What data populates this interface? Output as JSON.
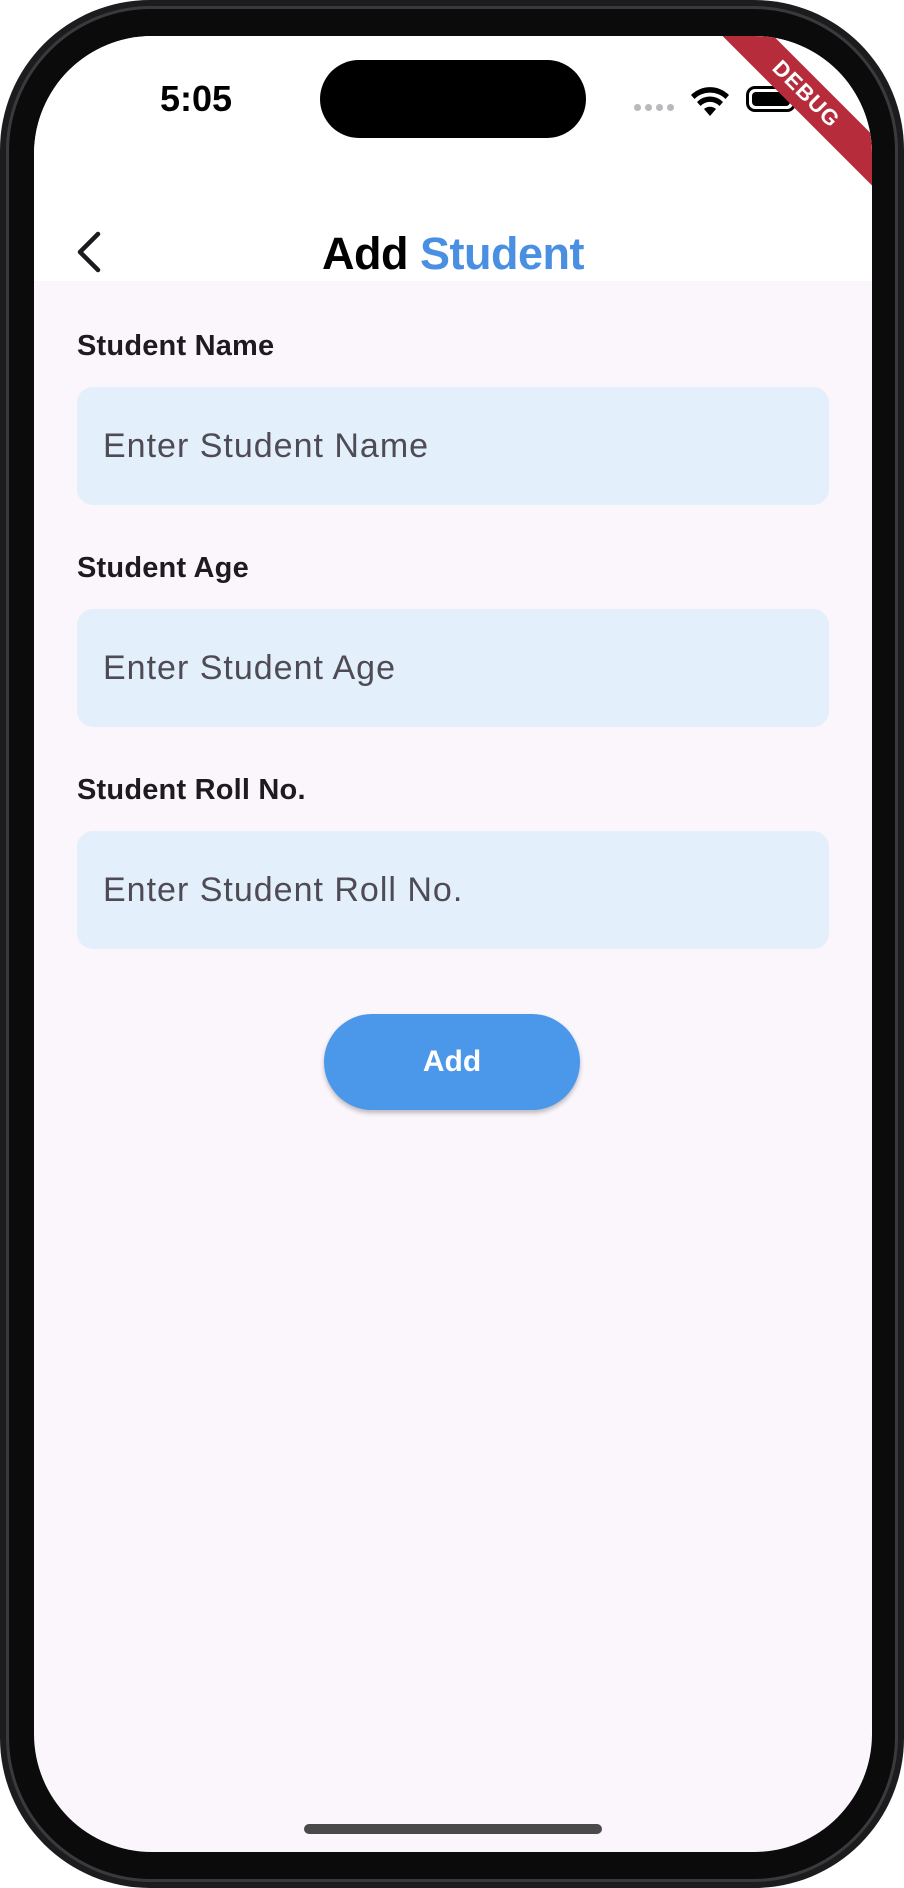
{
  "status_bar": {
    "time": "5:05"
  },
  "debug_banner": "DEBUG",
  "app_bar": {
    "title_part1": "Add",
    "title_part2": "Student",
    "back_icon": "chevron-left-icon",
    "accent_color": "#4a90e2"
  },
  "form": {
    "name": {
      "label": "Student Name",
      "placeholder": "Enter Student Name",
      "value": ""
    },
    "age": {
      "label": "Student Age",
      "placeholder": "Enter Student Age",
      "value": ""
    },
    "roll": {
      "label": "Student Roll No.",
      "placeholder": "Enter Student Roll No.",
      "value": ""
    },
    "submit_label": "Add"
  },
  "colors": {
    "background": "#fbf6fc",
    "input_fill": "#e3effa",
    "button": "#4b97ea"
  }
}
